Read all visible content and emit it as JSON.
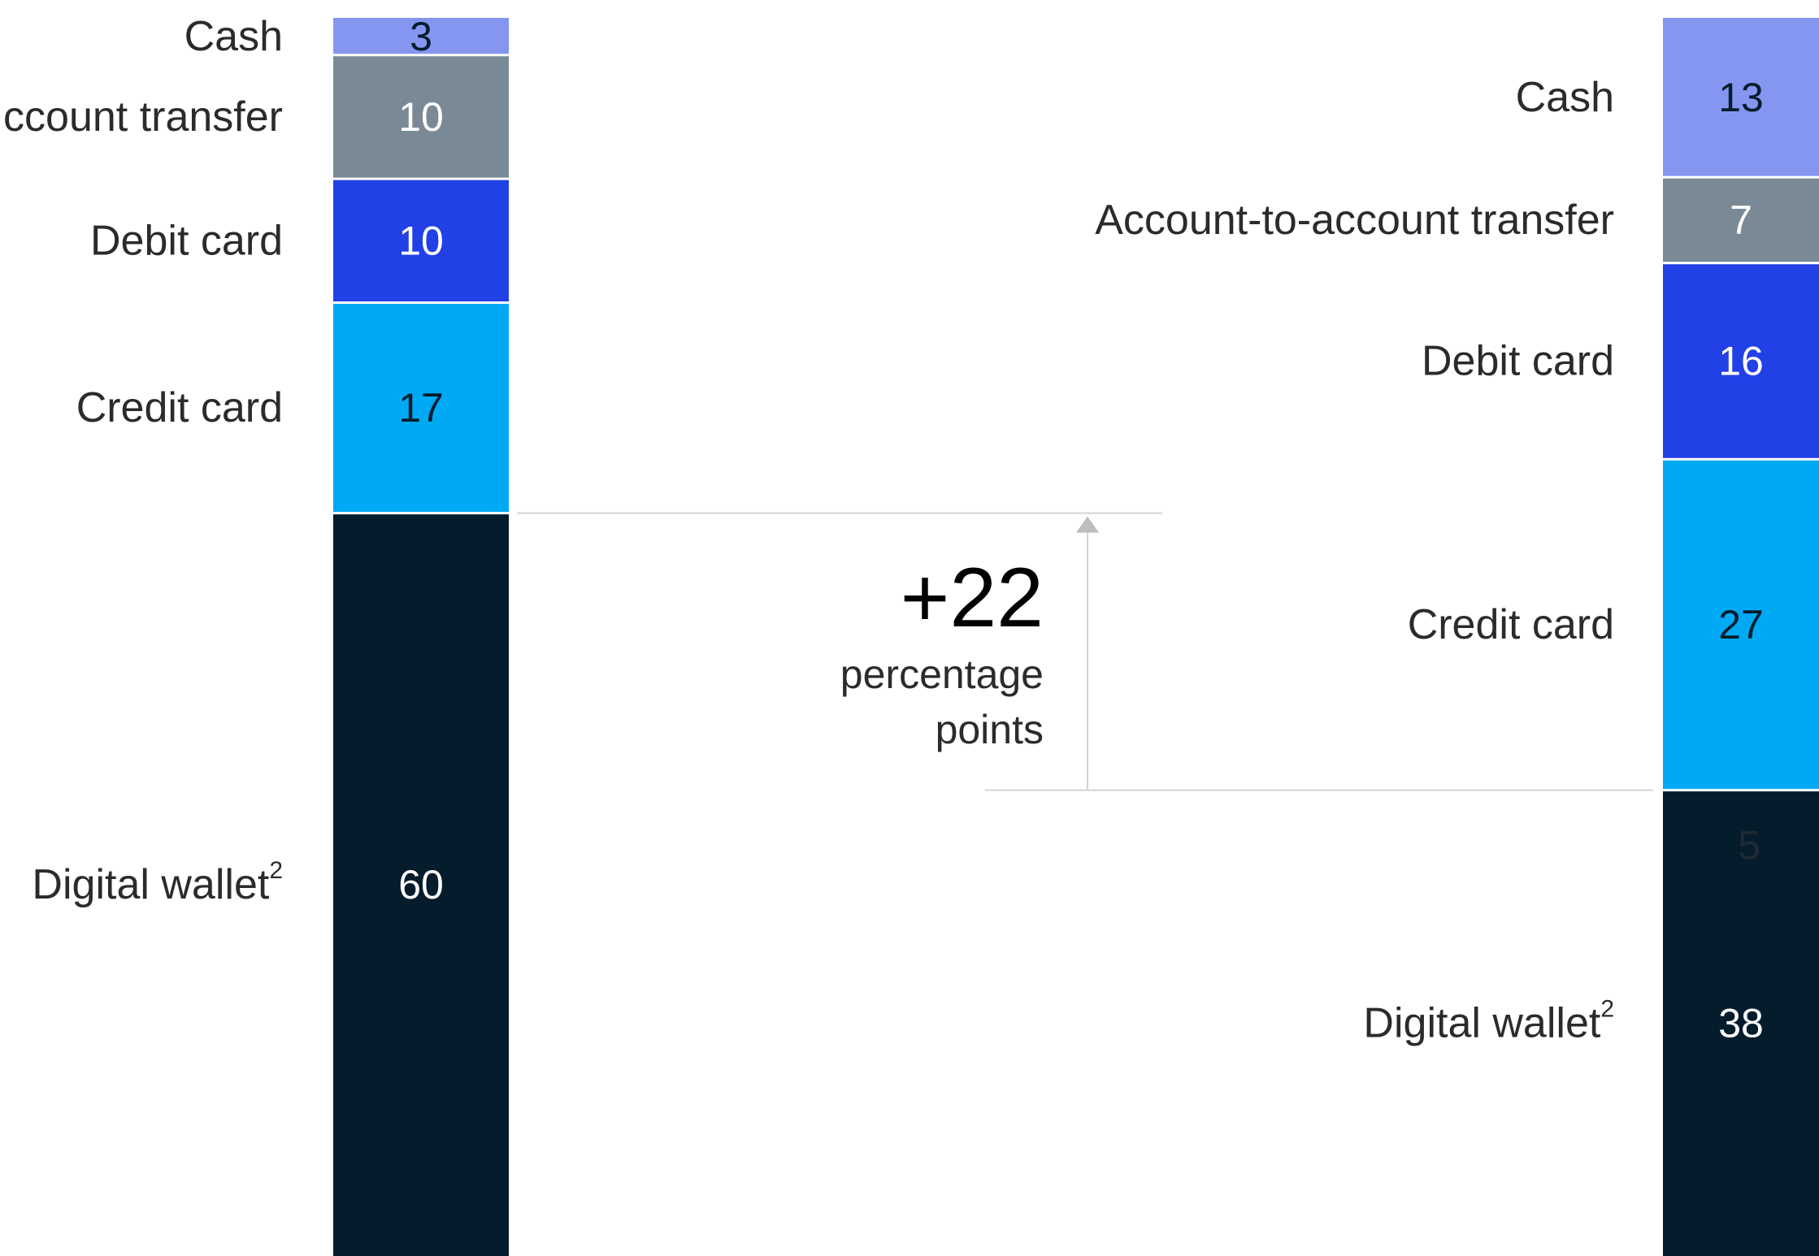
{
  "chart_data": {
    "type": "bar",
    "stacked": true,
    "segments": [
      "Digital wallet",
      "Credit card",
      "Debit card",
      "Account-to-account transfer",
      "Cash"
    ],
    "segment_display_labels": {
      "left": [
        "Digital wallet",
        "Credit card",
        "Debit card",
        "ccount transfer",
        "Cash"
      ],
      "right": [
        "Digital wallet",
        "Credit card",
        "Debit card",
        "Account-to-account transfer",
        "Cash"
      ]
    },
    "footnote_marker": "2",
    "colors": {
      "Digital wallet": "#051c2c",
      "Credit card": "#00a9f4",
      "Debit card": "#2140e6",
      "Account-to-account transfer": "#798a96",
      "Cash": "#8596f0"
    },
    "value_text_colors": {
      "Digital wallet": "#ffffff",
      "Credit card": "#051c2c",
      "Debit card": "#ffffff",
      "Account-to-account transfer": "#ffffff",
      "Cash": "#051c2c"
    },
    "bars": [
      {
        "values": [
          60,
          17,
          10,
          10,
          3
        ]
      },
      {
        "values": [
          38,
          27,
          16,
          7,
          13
        ],
        "inner_annotation": "5"
      }
    ],
    "annotation": {
      "value": "+22",
      "text_line1": "percentage",
      "text_line2": "points"
    },
    "ylim": [
      0,
      100
    ]
  }
}
